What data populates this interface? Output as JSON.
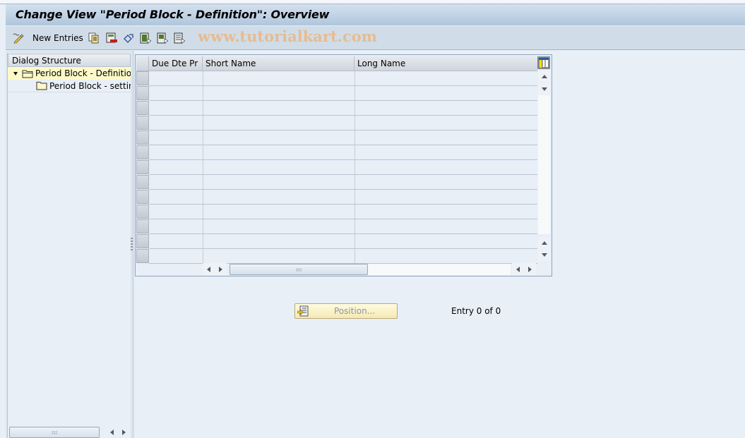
{
  "window": {
    "title": "Change View \"Period Block - Definition\": Overview"
  },
  "toolbar": {
    "items": [
      {
        "icon": "edit-pencil-icon",
        "label": ""
      },
      {
        "icon": "",
        "label": "New Entries"
      },
      {
        "icon": "copy-as-icon",
        "label": ""
      },
      {
        "icon": "delete-icon",
        "label": ""
      },
      {
        "icon": "undo-change-icon",
        "label": ""
      },
      {
        "icon": "select-all-icon",
        "label": ""
      },
      {
        "icon": "select-block-icon",
        "label": ""
      },
      {
        "icon": "deselect-all-icon",
        "label": ""
      }
    ],
    "new_entries_label": "New Entries",
    "watermark": "www.tutorialkart.com"
  },
  "dialog_structure": {
    "header": "Dialog Structure",
    "nodes": [
      {
        "label": "Period Block - Definition",
        "expanded": true,
        "selected": true,
        "icon": "folder-open-icon"
      },
      {
        "label": "Period Block - setting",
        "expanded": false,
        "selected": false,
        "icon": "folder-icon"
      }
    ]
  },
  "table": {
    "columns": [
      "Due Dte Pr",
      "Short Name",
      "Long Name"
    ],
    "rows": [],
    "visible_empty_rows": 13,
    "column_settings_icon": "table-settings-icon"
  },
  "footer": {
    "position_button_label": "Position...",
    "entry_text": "Entry 0 of 0"
  },
  "colors": {
    "title_bar": "#b0c6dc",
    "toolbar": "#d0dde8",
    "background": "#e8eff7",
    "selected_node": "#fef9c8",
    "watermark": "#e8b98a"
  }
}
